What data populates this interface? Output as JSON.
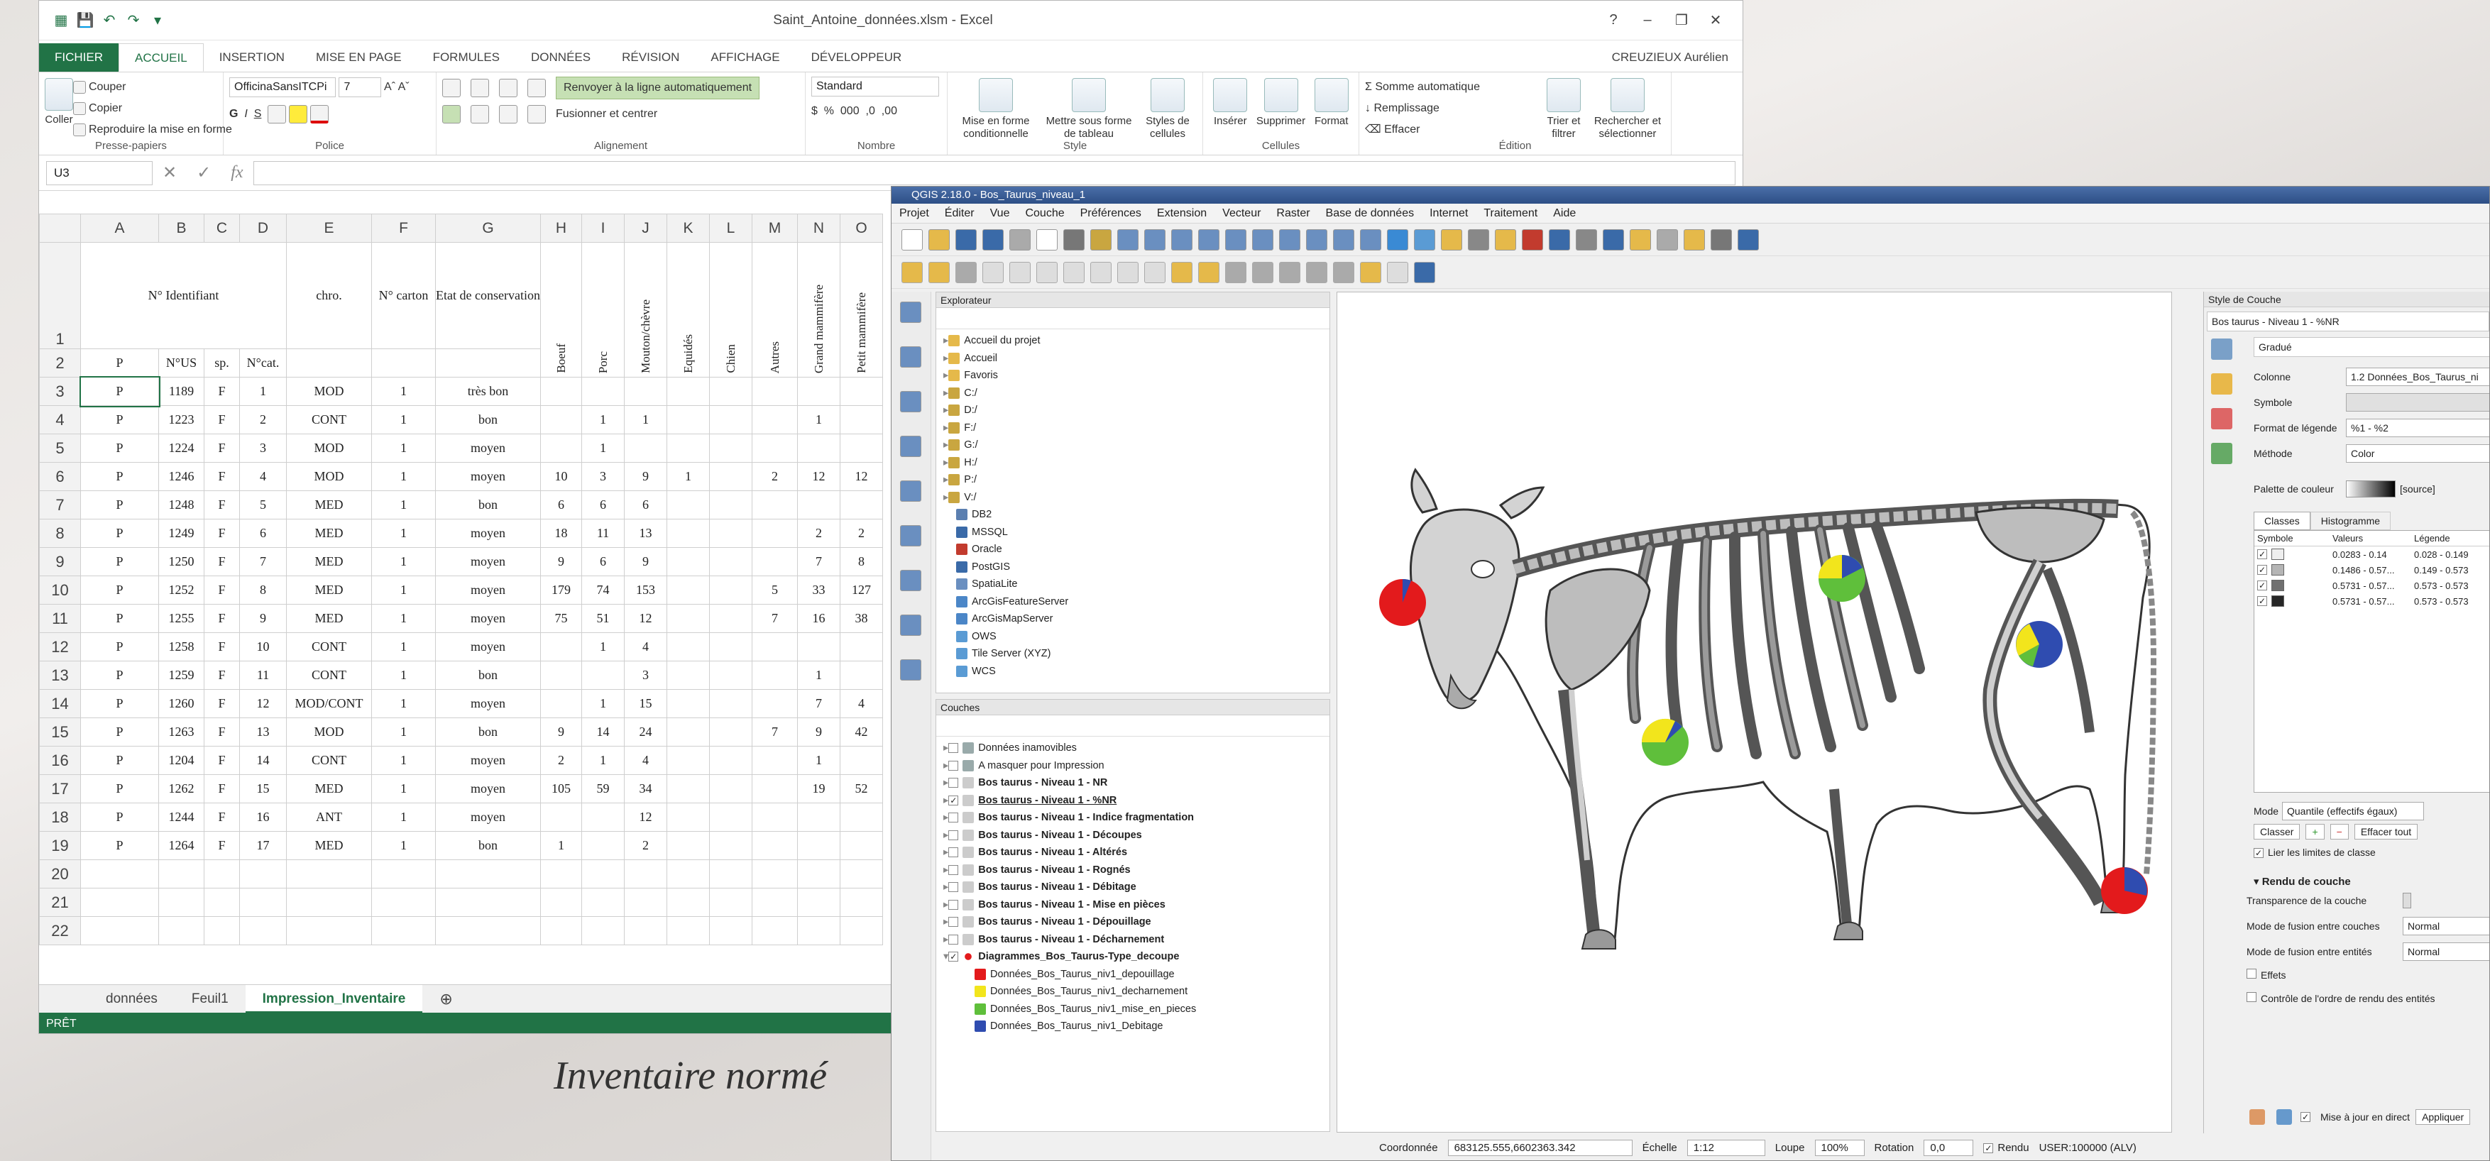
{
  "excel": {
    "title": "Saint_Antoine_données.xlsm - Excel",
    "user": "CREUZIEUX Aurélien",
    "tabs": [
      "FICHIER",
      "ACCUEIL",
      "INSERTION",
      "MISE EN PAGE",
      "FORMULES",
      "DONNÉES",
      "RÉVISION",
      "AFFICHAGE",
      "DÉVELOPPEUR"
    ],
    "ribbon": {
      "paste": "Coller",
      "cut": "Couper",
      "copy": "Copier",
      "format_painter": "Reproduire la mise en forme",
      "clipboard": "Presse-papiers",
      "font_name": "OfficinaSansITCPi",
      "font_size": "7",
      "font_group": "Police",
      "wrap": "Renvoyer à la ligne automatiquement",
      "merge": "Fusionner et centrer",
      "align_group": "Alignement",
      "number_format": "Standard",
      "number_group": "Nombre",
      "cond_format": "Mise en forme conditionnelle",
      "format_table": "Mettre sous forme de tableau",
      "cell_styles": "Styles de cellules",
      "style_group": "Style",
      "insert": "Insérer",
      "delete": "Supprimer",
      "format": "Format",
      "cells_group": "Cellules",
      "autosum": "Somme automatique",
      "fill": "Remplissage",
      "clear": "Effacer",
      "sort": "Trier et filtrer",
      "find": "Rechercher et sélectionner",
      "edit_group": "Édition"
    },
    "name_box": "U3",
    "fx": "fx",
    "columns": [
      "A",
      "B",
      "C",
      "D",
      "E",
      "F",
      "G",
      "H",
      "I",
      "J",
      "K",
      "L",
      "M",
      "N",
      "O"
    ],
    "header_row1": {
      "id": "N° Identifiant",
      "chro": "chro.",
      "carton": "N° carton",
      "etat": "Etat de conservation",
      "species": [
        "Boeuf",
        "Porc",
        "Mouton/chèvre",
        "Equidés",
        "Chien",
        "Autres",
        "Grand mammifère",
        "Petit mammifère"
      ]
    },
    "header_row2": [
      "P",
      "N°US",
      "sp.",
      "N°cat."
    ],
    "rows": [
      {
        "n": "3",
        "a": "P",
        "b": "1189",
        "c": "F",
        "d": "1",
        "e": "MOD",
        "f": "1",
        "g": "très bon",
        "h": "",
        "i": "",
        "j": "",
        "k": "",
        "l": "",
        "m": "",
        "nn": "",
        "o": ""
      },
      {
        "n": "4",
        "a": "P",
        "b": "1223",
        "c": "F",
        "d": "2",
        "e": "CONT",
        "f": "1",
        "g": "bon",
        "h": "",
        "i": "1",
        "j": "1",
        "k": "",
        "l": "",
        "m": "",
        "nn": "1",
        "o": ""
      },
      {
        "n": "5",
        "a": "P",
        "b": "1224",
        "c": "F",
        "d": "3",
        "e": "MOD",
        "f": "1",
        "g": "moyen",
        "h": "",
        "i": "1",
        "j": "",
        "k": "",
        "l": "",
        "m": "",
        "nn": "",
        "o": ""
      },
      {
        "n": "6",
        "a": "P",
        "b": "1246",
        "c": "F",
        "d": "4",
        "e": "MOD",
        "f": "1",
        "g": "moyen",
        "h": "10",
        "i": "3",
        "j": "9",
        "k": "1",
        "l": "",
        "m": "2",
        "nn": "12",
        "o": "12"
      },
      {
        "n": "7",
        "a": "P",
        "b": "1248",
        "c": "F",
        "d": "5",
        "e": "MED",
        "f": "1",
        "g": "bon",
        "h": "6",
        "i": "6",
        "j": "6",
        "k": "",
        "l": "",
        "m": "",
        "nn": "",
        "o": ""
      },
      {
        "n": "8",
        "a": "P",
        "b": "1249",
        "c": "F",
        "d": "6",
        "e": "MED",
        "f": "1",
        "g": "moyen",
        "h": "18",
        "i": "11",
        "j": "13",
        "k": "",
        "l": "",
        "m": "",
        "nn": "2",
        "o": "2"
      },
      {
        "n": "9",
        "a": "P",
        "b": "1250",
        "c": "F",
        "d": "7",
        "e": "MED",
        "f": "1",
        "g": "moyen",
        "h": "9",
        "i": "6",
        "j": "9",
        "k": "",
        "l": "",
        "m": "",
        "nn": "7",
        "o": "8"
      },
      {
        "n": "10",
        "a": "P",
        "b": "1252",
        "c": "F",
        "d": "8",
        "e": "MED",
        "f": "1",
        "g": "moyen",
        "h": "179",
        "i": "74",
        "j": "153",
        "k": "",
        "l": "",
        "m": "5",
        "nn": "33",
        "o": "127"
      },
      {
        "n": "11",
        "a": "P",
        "b": "1255",
        "c": "F",
        "d": "9",
        "e": "MED",
        "f": "1",
        "g": "moyen",
        "h": "75",
        "i": "51",
        "j": "12",
        "k": "",
        "l": "",
        "m": "7",
        "nn": "16",
        "o": "38"
      },
      {
        "n": "12",
        "a": "P",
        "b": "1258",
        "c": "F",
        "d": "10",
        "e": "CONT",
        "f": "1",
        "g": "moyen",
        "h": "",
        "i": "1",
        "j": "4",
        "k": "",
        "l": "",
        "m": "",
        "nn": "",
        "o": ""
      },
      {
        "n": "13",
        "a": "P",
        "b": "1259",
        "c": "F",
        "d": "11",
        "e": "CONT",
        "f": "1",
        "g": "bon",
        "h": "",
        "i": "",
        "j": "3",
        "k": "",
        "l": "",
        "m": "",
        "nn": "1",
        "o": ""
      },
      {
        "n": "14",
        "a": "P",
        "b": "1260",
        "c": "F",
        "d": "12",
        "e": "MOD/CONT",
        "f": "1",
        "g": "moyen",
        "h": "",
        "i": "1",
        "j": "15",
        "k": "",
        "l": "",
        "m": "",
        "nn": "7",
        "o": "4"
      },
      {
        "n": "15",
        "a": "P",
        "b": "1263",
        "c": "F",
        "d": "13",
        "e": "MOD",
        "f": "1",
        "g": "bon",
        "h": "9",
        "i": "14",
        "j": "24",
        "k": "",
        "l": "",
        "m": "7",
        "nn": "9",
        "o": "42"
      },
      {
        "n": "16",
        "a": "P",
        "b": "1204",
        "c": "F",
        "d": "14",
        "e": "CONT",
        "f": "1",
        "g": "moyen",
        "h": "2",
        "i": "1",
        "j": "4",
        "k": "",
        "l": "",
        "m": "",
        "nn": "1",
        "o": ""
      },
      {
        "n": "17",
        "a": "P",
        "b": "1262",
        "c": "F",
        "d": "15",
        "e": "MED",
        "f": "1",
        "g": "moyen",
        "h": "105",
        "i": "59",
        "j": "34",
        "k": "",
        "l": "",
        "m": "",
        "nn": "19",
        "o": "52"
      },
      {
        "n": "18",
        "a": "P",
        "b": "1244",
        "c": "F",
        "d": "16",
        "e": "ANT",
        "f": "1",
        "g": "moyen",
        "h": "",
        "i": "",
        "j": "12",
        "k": "",
        "l": "",
        "m": "",
        "nn": "",
        "o": ""
      },
      {
        "n": "19",
        "a": "P",
        "b": "1264",
        "c": "F",
        "d": "17",
        "e": "MED",
        "f": "1",
        "g": "bon",
        "h": "1",
        "i": "",
        "j": "2",
        "k": "",
        "l": "",
        "m": "",
        "nn": "",
        "o": ""
      },
      {
        "n": "20",
        "a": "",
        "b": "",
        "c": "",
        "d": "",
        "e": "",
        "f": "",
        "g": "",
        "h": "",
        "i": "",
        "j": "",
        "k": "",
        "l": "",
        "m": "",
        "nn": "",
        "o": ""
      },
      {
        "n": "21",
        "a": "",
        "b": "",
        "c": "",
        "d": "",
        "e": "",
        "f": "",
        "g": "",
        "h": "",
        "i": "",
        "j": "",
        "k": "",
        "l": "",
        "m": "",
        "nn": "",
        "o": ""
      },
      {
        "n": "22",
        "a": "",
        "b": "",
        "c": "",
        "d": "",
        "e": "",
        "f": "",
        "g": "",
        "h": "",
        "i": "",
        "j": "",
        "k": "",
        "l": "",
        "m": "",
        "nn": "",
        "o": ""
      }
    ],
    "sheets": [
      "données",
      "Feuil1",
      "Impression_Inventaire"
    ],
    "status": "PRÊT"
  },
  "caption": "Inventaire normé",
  "qgis": {
    "title": "QGIS 2.18.0 - Bos_Taurus_niveau_1",
    "menu": [
      "Projet",
      "Éditer",
      "Vue",
      "Couche",
      "Préférences",
      "Extension",
      "Vecteur",
      "Raster",
      "Base de données",
      "Internet",
      "Traitement",
      "Aide"
    ],
    "browser_title": "Explorateur",
    "browser_items": [
      "Accueil du projet",
      "Accueil",
      "Favoris",
      "C:/",
      "D:/",
      "F:/",
      "G:/",
      "H:/",
      "P:/",
      "V:/",
      "DB2",
      "MSSQL",
      "Oracle",
      "PostGIS",
      "SpatiaLite",
      "ArcGisFeatureServer",
      "ArcGisMapServer",
      "OWS",
      "Tile Server (XYZ)",
      "WCS"
    ],
    "layers_title": "Couches",
    "layers": [
      {
        "label": "Données inamovibles",
        "bold": false,
        "checked": false
      },
      {
        "label": "A masquer pour Impression",
        "bold": false,
        "checked": false
      },
      {
        "label": "Bos taurus - Niveau 1 - NR",
        "bold": true,
        "checked": false
      },
      {
        "label": "Bos taurus - Niveau 1 - %NR",
        "bold": true,
        "checked": true
      },
      {
        "label": "Bos taurus - Niveau 1 - Indice fragmentation",
        "bold": true,
        "checked": false
      },
      {
        "label": "Bos taurus - Niveau 1 - Découpes",
        "bold": true,
        "checked": false
      },
      {
        "label": "Bos taurus - Niveau 1 - Altérés",
        "bold": true,
        "checked": false
      },
      {
        "label": "Bos taurus - Niveau 1 - Rognés",
        "bold": true,
        "checked": false
      },
      {
        "label": "Bos taurus - Niveau 1 - Débitage",
        "bold": true,
        "checked": false
      },
      {
        "label": "Bos taurus - Niveau 1 - Mise en pièces",
        "bold": true,
        "checked": false
      },
      {
        "label": "Bos taurus - Niveau 1 - Dépouillage",
        "bold": true,
        "checked": false
      },
      {
        "label": "Bos taurus - Niveau 1 - Décharnement",
        "bold": true,
        "checked": false
      },
      {
        "label": "Diagrammes_Bos_Taurus-Type_decoupe",
        "bold": true,
        "checked": true
      }
    ],
    "legend": [
      {
        "label": "Données_Bos_Taurus_niv1_depouillage",
        "color": "#e31a1c"
      },
      {
        "label": "Données_Bos_Taurus_niv1_decharnement",
        "color": "#f2e51c"
      },
      {
        "label": "Données_Bos_Taurus_niv1_mise_en_pieces",
        "color": "#5fbf3b"
      },
      {
        "label": "Données_Bos_Taurus_niv1_Debitage",
        "color": "#2f4cb0"
      }
    ],
    "style": {
      "title": "Style de Couche",
      "layer": "Bos taurus - Niveau 1 - %NR",
      "renderer": "Gradué",
      "column_label": "Colonne",
      "column": "1.2  Données_Bos_Taurus_ni",
      "symbol_label": "Symbole",
      "legend_format_label": "Format de légende",
      "legend_format": "%1 - %2",
      "method_label": "Méthode",
      "method": "Color",
      "palette_label": "Palette de couleur",
      "palette": "[source]",
      "tab_classes": "Classes",
      "tab_histogram": "Histogramme",
      "col_symbol": "Symbole",
      "col_values": "Valeurs",
      "col_legend": "Légende",
      "classes": [
        {
          "values": "0.0283 - 0.14",
          "legend": "0.028 - 0.149",
          "color": "#eeeeee"
        },
        {
          "values": "0.1486 - 0.57...",
          "legend": "0.149 - 0.573",
          "color": "#b5b5b5"
        },
        {
          "values": "0.5731 - 0.57...",
          "legend": "0.573 - 0.573",
          "color": "#707070"
        },
        {
          "values": "0.5731 - 0.57...",
          "legend": "0.573 - 0.573",
          "color": "#262626"
        }
      ],
      "mode_label": "Mode",
      "mode": "Quantile (effectifs égaux)",
      "classify": "Classer",
      "delete_all": "Effacer tout",
      "link_limits": "Lier les limites de classe",
      "render_section": "Rendu de couche",
      "transparency": "Transparence de la couche",
      "blend_layers": "Mode de fusion entre couches",
      "blend_layers_val": "Normal",
      "blend_entities": "Mode de fusion entre entités",
      "blend_entities_val": "Normal",
      "effects": "Effets",
      "order_control": "Contrôle de l'ordre de rendu des entités",
      "live_update": "Mise à jour en direct",
      "apply": "Appliquer"
    },
    "status": {
      "coord_label": "Coordonnée",
      "coord": "683125.555,6602363.342",
      "scale_label": "Échelle",
      "scale": "1:12",
      "magnifier_label": "Loupe",
      "magnifier": "100%",
      "rotation_label": "Rotation",
      "rotation": "0,0",
      "render": "Rendu",
      "crs": "USER:100000 (ALV)"
    }
  }
}
